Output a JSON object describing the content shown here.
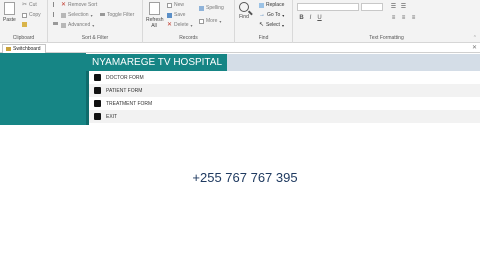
{
  "ribbon": {
    "clipboard": {
      "paste_label": "Paste",
      "cut_label": "Cut",
      "copy_label": "Copy",
      "group_label": "Clipboard"
    },
    "sort_filter": {
      "remove_sort_label": "Remove Sort",
      "selection_label": "Selection",
      "advanced_label": "Advanced",
      "toggle_filter_label": "Toggle Filter",
      "group_label": "Sort & Filter"
    },
    "records": {
      "refresh_label": "Refresh All",
      "new_label": "New",
      "save_label": "Save",
      "delete_label": "Delete",
      "spelling_label": "Spelling",
      "more_label": "More",
      "group_label": "Records"
    },
    "find": {
      "find_label": "Find",
      "replace_label": "Replace",
      "goto_label": "Go To",
      "select_label": "Select",
      "group_label": "Find"
    },
    "text_formatting": {
      "group_label": "Text Formatting"
    }
  },
  "tabs": [
    {
      "label": "Switchboard"
    }
  ],
  "form": {
    "title": "NYAMAREGE TV HOSPITAL",
    "menu_items": [
      {
        "label": "DOCTOR FORM"
      },
      {
        "label": "PATIENT FORM"
      },
      {
        "label": "TREATMENT FORM"
      },
      {
        "label": "EXIT"
      }
    ],
    "phone": "+255 767 767 395"
  },
  "colors": {
    "accent_teal": "#168585",
    "title_band": "#d4dde7",
    "phone_text": "#1f3a60"
  }
}
